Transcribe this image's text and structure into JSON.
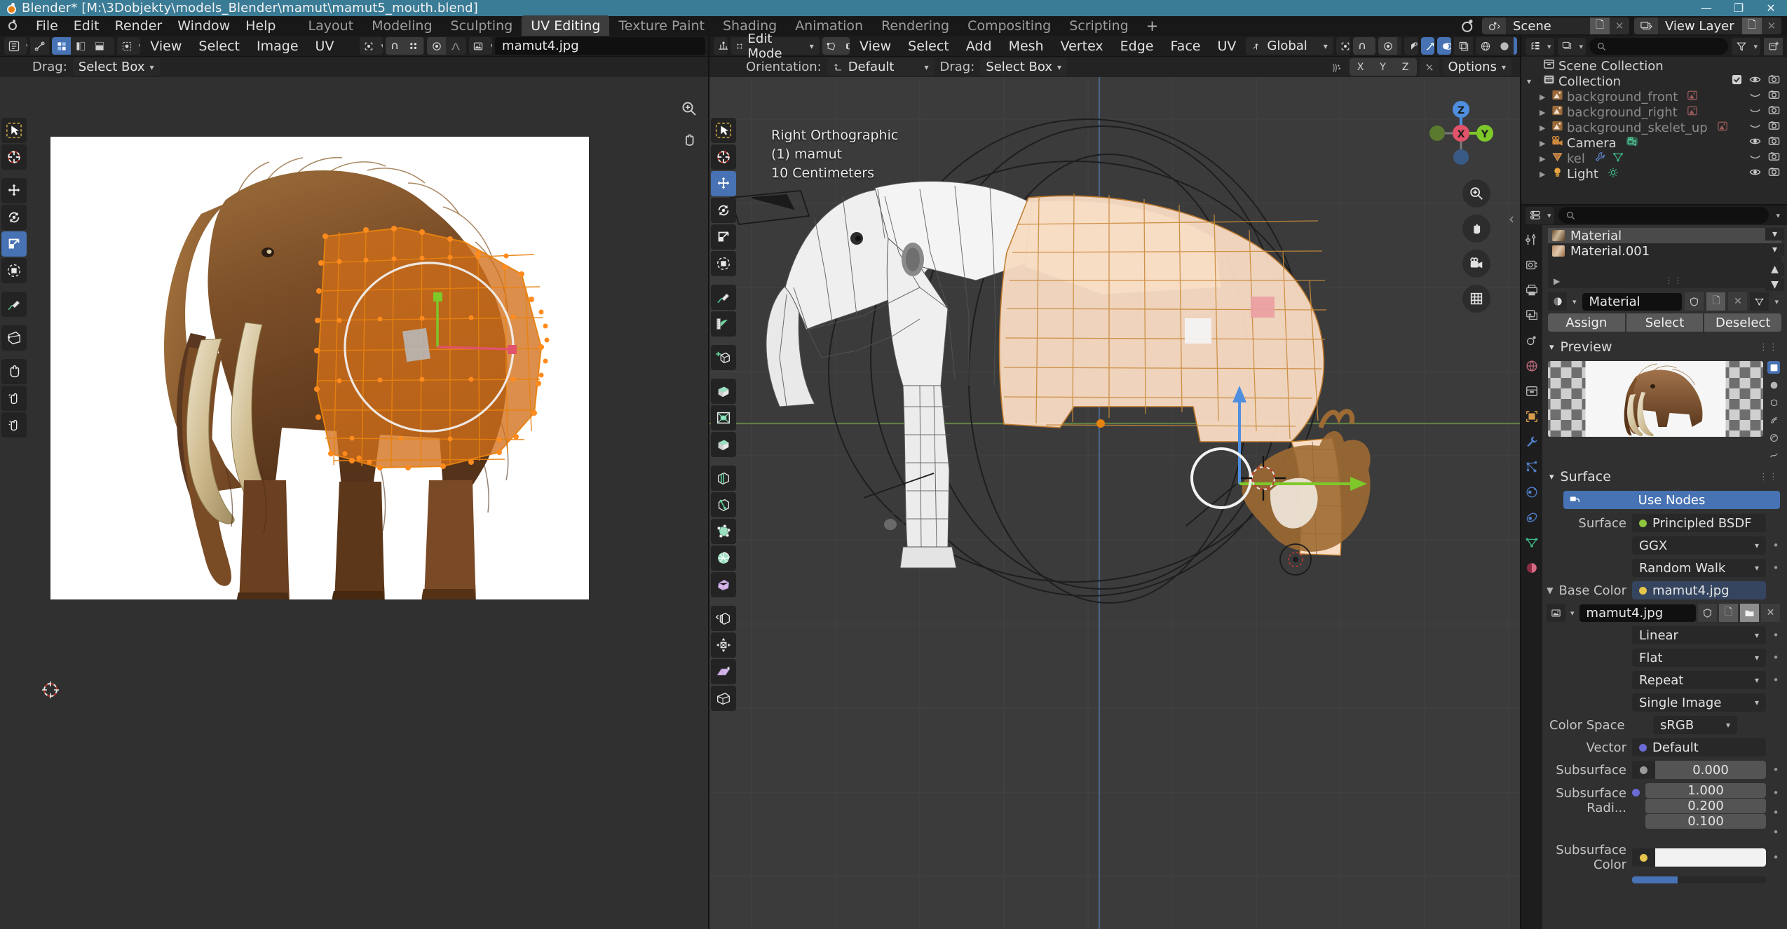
{
  "titlebar": {
    "title": "Blender* [M:\\3Dobjekty\\models_Blender\\mamut\\mamut5_mouth.blend]",
    "minimize": "—",
    "maximize": "❐",
    "close": "✕"
  },
  "menubar": {
    "items": [
      "File",
      "Edit",
      "Render",
      "Window",
      "Help"
    ],
    "workspaces": [
      {
        "label": "Layout",
        "active": false
      },
      {
        "label": "Modeling",
        "active": false
      },
      {
        "label": "Sculpting",
        "active": false
      },
      {
        "label": "UV Editing",
        "active": true
      },
      {
        "label": "Texture Paint",
        "active": false
      },
      {
        "label": "Shading",
        "active": false
      },
      {
        "label": "Animation",
        "active": false
      },
      {
        "label": "Rendering",
        "active": false
      },
      {
        "label": "Compositing",
        "active": false
      },
      {
        "label": "Scripting",
        "active": false
      }
    ],
    "add_workspace": "+",
    "scene": "Scene",
    "view_layer": "View Layer"
  },
  "uv_editor": {
    "menus": [
      "View",
      "Select",
      "Image",
      "UV"
    ],
    "image_name": "mamut4.jpg",
    "drag_label": "Drag:",
    "drag_value": "Select Box",
    "tools": [
      {
        "name": "tweak-tool",
        "active": false
      },
      {
        "name": "cursor-tool",
        "active": false
      },
      {
        "name": "move-tool",
        "active": false
      },
      {
        "name": "rotate-tool",
        "active": false
      },
      {
        "name": "scale-tool",
        "active": true
      },
      {
        "name": "transform-tool",
        "active": false
      },
      {
        "name": "annotate-tool",
        "active": false
      },
      {
        "name": "measure-tool",
        "active": false
      },
      {
        "name": "grab-tool",
        "active": false
      },
      {
        "name": "relax-tool",
        "active": false
      },
      {
        "name": "pinch-tool",
        "active": false
      }
    ]
  },
  "view3d": {
    "mode": "Edit Mode",
    "menus": [
      "View",
      "Select",
      "Add",
      "Mesh",
      "Vertex",
      "Edge",
      "Face",
      "UV"
    ],
    "orientation_label": "Orientation:",
    "orientation_value": "Default",
    "drag_label": "Drag:",
    "drag_value": "Select Box",
    "transform_space": "Global",
    "options_label": "Options",
    "axis_buttons": [
      "X",
      "Y",
      "Z"
    ],
    "overlay_lines": [
      "Right Orthographic",
      "(1) mamut",
      "10 Centimeters"
    ],
    "gizmo_axes": [
      "Z",
      "X",
      "Y"
    ]
  },
  "outliner": {
    "search_placeholder": "",
    "rows": [
      {
        "label": "Scene Collection",
        "icon": "collection-icon",
        "indent": 0,
        "dimmed": false,
        "expandable": false,
        "checkbox": false,
        "eye": false,
        "camera": false
      },
      {
        "label": "Collection",
        "icon": "collection-icon",
        "indent": 1,
        "dimmed": false,
        "expandable": true,
        "checkbox": true,
        "eye": true,
        "camera": true
      },
      {
        "label": "background_front",
        "icon": "image-object-icon",
        "indent": 2,
        "dimmed": true,
        "expandable": true,
        "checkbox": false,
        "eye": "closed",
        "camera": true
      },
      {
        "label": "background_right",
        "icon": "image-object-icon",
        "indent": 2,
        "dimmed": true,
        "expandable": true,
        "checkbox": false,
        "eye": "closed",
        "camera": true
      },
      {
        "label": "background_skelet_up",
        "icon": "image-object-icon",
        "indent": 2,
        "dimmed": true,
        "expandable": true,
        "checkbox": false,
        "eye": "closed",
        "camera": true
      },
      {
        "label": "Camera",
        "icon": "camera-object-icon",
        "indent": 2,
        "dimmed": false,
        "expandable": true,
        "checkbox": false,
        "eye": true,
        "camera": true
      },
      {
        "label": "kel",
        "icon": "mesh-object-icon",
        "indent": 2,
        "dimmed": true,
        "expandable": true,
        "checkbox": false,
        "eye": "closed",
        "camera": true
      },
      {
        "label": "Light",
        "icon": "light-object-icon",
        "indent": 2,
        "dimmed": false,
        "expandable": true,
        "checkbox": false,
        "eye": true,
        "camera": true
      }
    ]
  },
  "properties": {
    "search_placeholder": "",
    "material_slots": [
      {
        "name": "Material",
        "selected": true
      },
      {
        "name": "Material.001",
        "selected": false
      }
    ],
    "material_name": "Material",
    "assign_buttons": [
      "Assign",
      "Select",
      "Deselect"
    ],
    "preview_title": "Preview",
    "surface_title": "Surface",
    "use_nodes": "Use Nodes",
    "surface_label": "Surface",
    "surface_value": "Principled BSDF",
    "distribution": "GGX",
    "subsurface_method": "Random Walk",
    "base_color_label": "Base Color",
    "base_color_value": "mamut4.jpg",
    "image_name": "mamut4.jpg",
    "interpolation": "Linear",
    "projection": "Flat",
    "extension": "Repeat",
    "source": "Single Image",
    "color_space_label": "Color Space",
    "color_space_value": "sRGB",
    "vector_label": "Vector",
    "vector_value": "Default",
    "subsurface_label": "Subsurface",
    "subsurface_value": "0.000",
    "subsurface_radius_label": "Subsurface Radi...",
    "subsurface_radius": [
      "1.000",
      "0.200",
      "0.100"
    ],
    "subsurface_color_label": "Subsurface Color"
  },
  "colors": {
    "accent_blue": "#4772b3",
    "title_bar": "#3a7b96",
    "selected_orange": "#ff8b1e",
    "axis_x": "#e64b5f",
    "axis_y": "#8cc63e",
    "axis_z": "#3b82d8"
  }
}
